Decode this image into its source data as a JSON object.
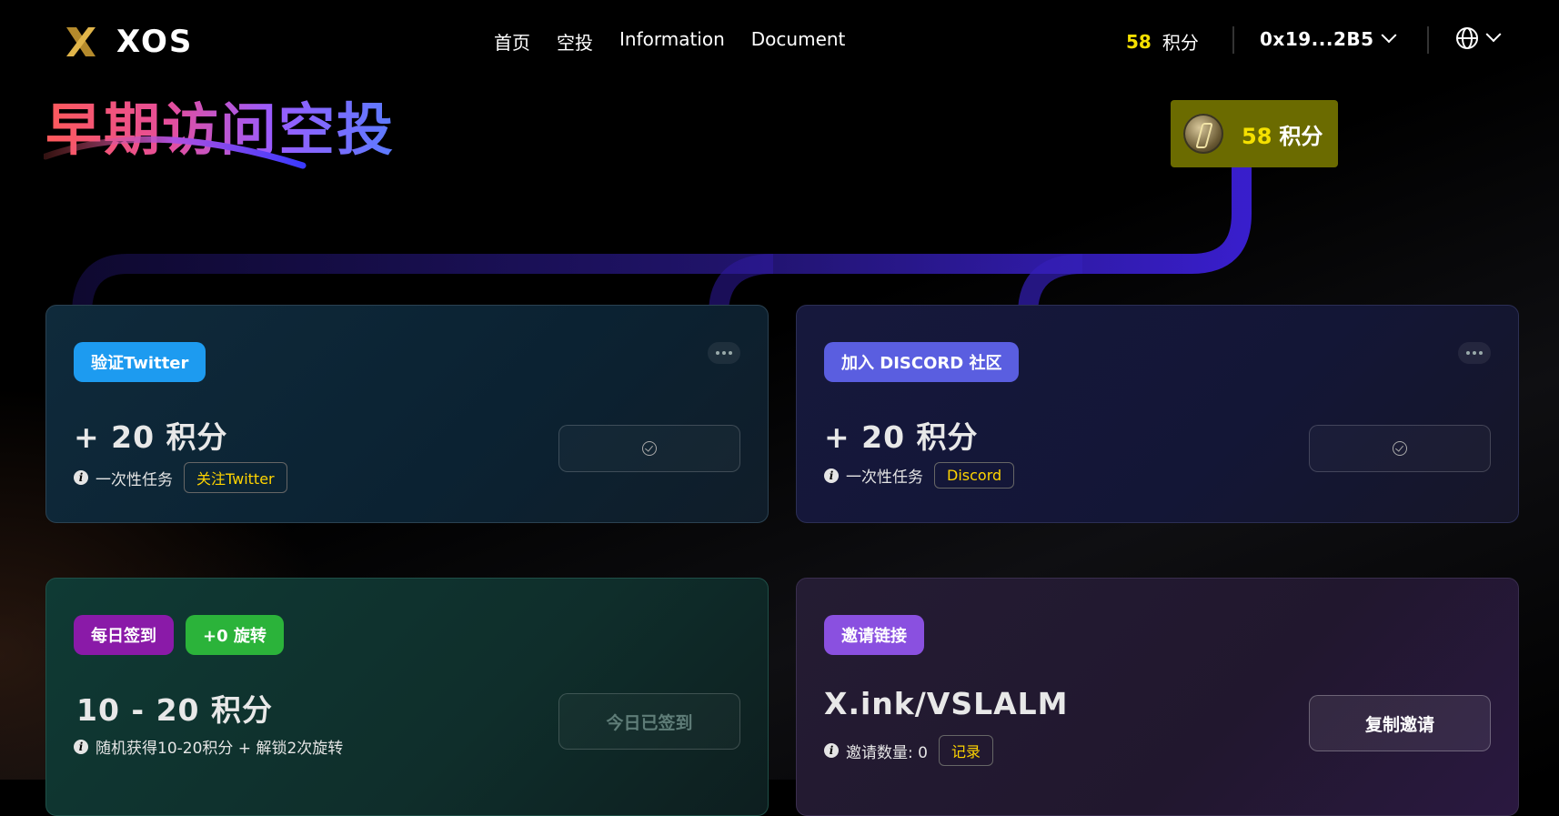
{
  "header": {
    "logo_text": "XOS",
    "nav": [
      "首页",
      "空投",
      "Information",
      "Document"
    ],
    "points_value": "58",
    "points_unit": "积分",
    "wallet": "0x19...2B5"
  },
  "hero": {
    "title": "早期访问空投",
    "badge_value": "58",
    "badge_unit": "积分"
  },
  "cards": {
    "twitter": {
      "tag": "验证Twitter",
      "reward": "+ 20 积分",
      "info": "一次性任务",
      "link": "关注Twitter"
    },
    "discord": {
      "tag": "加入 DISCORD 社区",
      "reward": "+ 20 积分",
      "info": "一次性任务",
      "link": "Discord"
    },
    "checkin": {
      "tag": "每日签到",
      "tag2": "+0 旋转",
      "reward": "10 - 20 积分",
      "info": "随机获得10-20积分 + 解锁2次旋转",
      "button": "今日已签到"
    },
    "invite": {
      "tag": "邀请链接",
      "reward": "X.ink/VSLALM",
      "info": "邀请数量: 0",
      "link": "记录",
      "button": "复制邀请"
    }
  },
  "colors": {
    "accent_yellow": "#f5e000",
    "twitter_tag": "#1d9bf0",
    "discord_tag": "#5a5ee0",
    "checkin_tag": "#8a1aa8",
    "spin_tag": "#2bb33a",
    "invite_tag": "#8a50e0",
    "track": "#3b1fd6"
  }
}
